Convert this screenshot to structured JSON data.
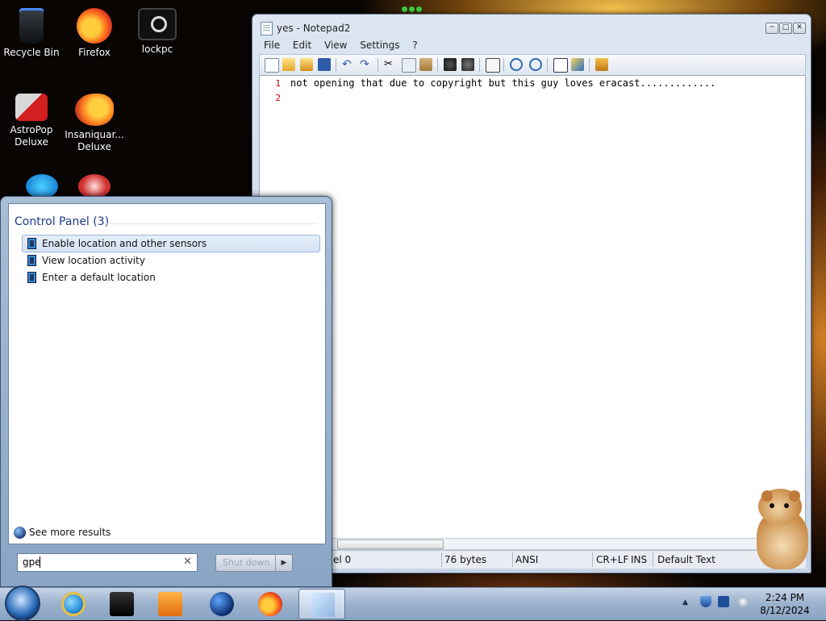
{
  "desktop": {
    "icons": [
      {
        "label": "Recycle Bin",
        "icon": "recycle-bin-icon"
      },
      {
        "label": "Firefox",
        "icon": "firefox-icon"
      },
      {
        "label": "lockpc",
        "icon": "lockpc-icon"
      },
      {
        "label": "AstroPop Deluxe",
        "icon": "astropop-icon"
      },
      {
        "label": "Insaniquar... Deluxe",
        "icon": "insaniquarium-icon"
      }
    ]
  },
  "notepad": {
    "title": "yes - Notepad2",
    "controls": {
      "minimize": "─",
      "maximize": "□",
      "close": "✕"
    },
    "menu": [
      "File",
      "Edit",
      "View",
      "Settings",
      "?"
    ],
    "lines": [
      {
        "number": "1",
        "text": "not opening that due to copyright but this guy loves eracast............."
      },
      {
        "number": "2",
        "text": ""
      }
    ],
    "status": {
      "position": "el 0",
      "size": "76 bytes",
      "encoding": "ANSI",
      "line_endings": "CR+LF",
      "insert_mode": "INS",
      "scheme": "Default Text"
    }
  },
  "start_menu": {
    "group_heading": "Control Panel (3)",
    "results": [
      {
        "label": "Enable location and other sensors",
        "selected": true
      },
      {
        "label": "View location activity",
        "selected": false
      },
      {
        "label": "Enter a default location",
        "selected": false
      }
    ],
    "see_more": "See more results",
    "search_value": "gpe",
    "clear_glyph": "✕",
    "shutdown_label": "Shut down",
    "shutdown_arrow": "▶"
  },
  "taskbar": {
    "apps": [
      "internet-explorer-icon",
      "lockpc-icon",
      "media-player-icon",
      "earth-icon",
      "firefox-icon",
      "notepad2-icon"
    ],
    "tray_arrow": "▲",
    "clock_time": "2:24 PM",
    "clock_date": "8/12/2024"
  },
  "colors": {
    "heading": "#1e3a8a",
    "line_number": "#cc0000",
    "selection": "#d4e2f4"
  }
}
